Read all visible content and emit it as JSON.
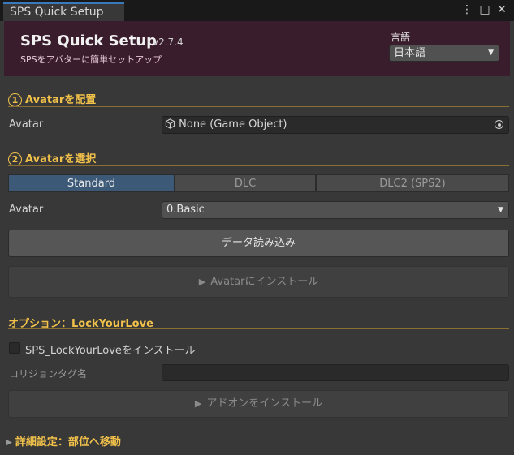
{
  "tab": {
    "title": "SPS Quick Setup"
  },
  "window_controls": {
    "menu": "⋮",
    "maximize": "□",
    "close": "✕"
  },
  "header": {
    "title": "SPS Quick Setup",
    "version": "v2.7.4",
    "subtitle": "SPSをアバターに簡単セットアップ",
    "language_label": "言語",
    "language_value": "日本語"
  },
  "section1": {
    "number": "1",
    "title": "Avatarを配置",
    "field_label": "Avatar",
    "field_value": "None (Game Object)"
  },
  "section2": {
    "number": "2",
    "title": "Avatarを選択",
    "tabs": [
      "Standard",
      "DLC",
      "DLC2 (SPS2)"
    ],
    "active_tab": "Standard",
    "avatar_label": "Avatar",
    "avatar_value": "0.Basic",
    "load_button": "データ読み込み",
    "install_button": "Avatarにインストール"
  },
  "option": {
    "title": "オプション：LockYourLove",
    "checkbox_label": "SPS_LockYourLoveをインストール",
    "checkbox_checked": false,
    "collision_tag_label": "コリジョンタグ名",
    "collision_tag_value": "",
    "addon_button": "アドオンをインストール"
  },
  "advanced": {
    "title": "詳細設定：部位へ移動"
  },
  "colors": {
    "accent": "#f1c14a",
    "header_bg": "#3a1d2c",
    "panel_bg": "#383838",
    "active_tab": "#3c5a78"
  }
}
